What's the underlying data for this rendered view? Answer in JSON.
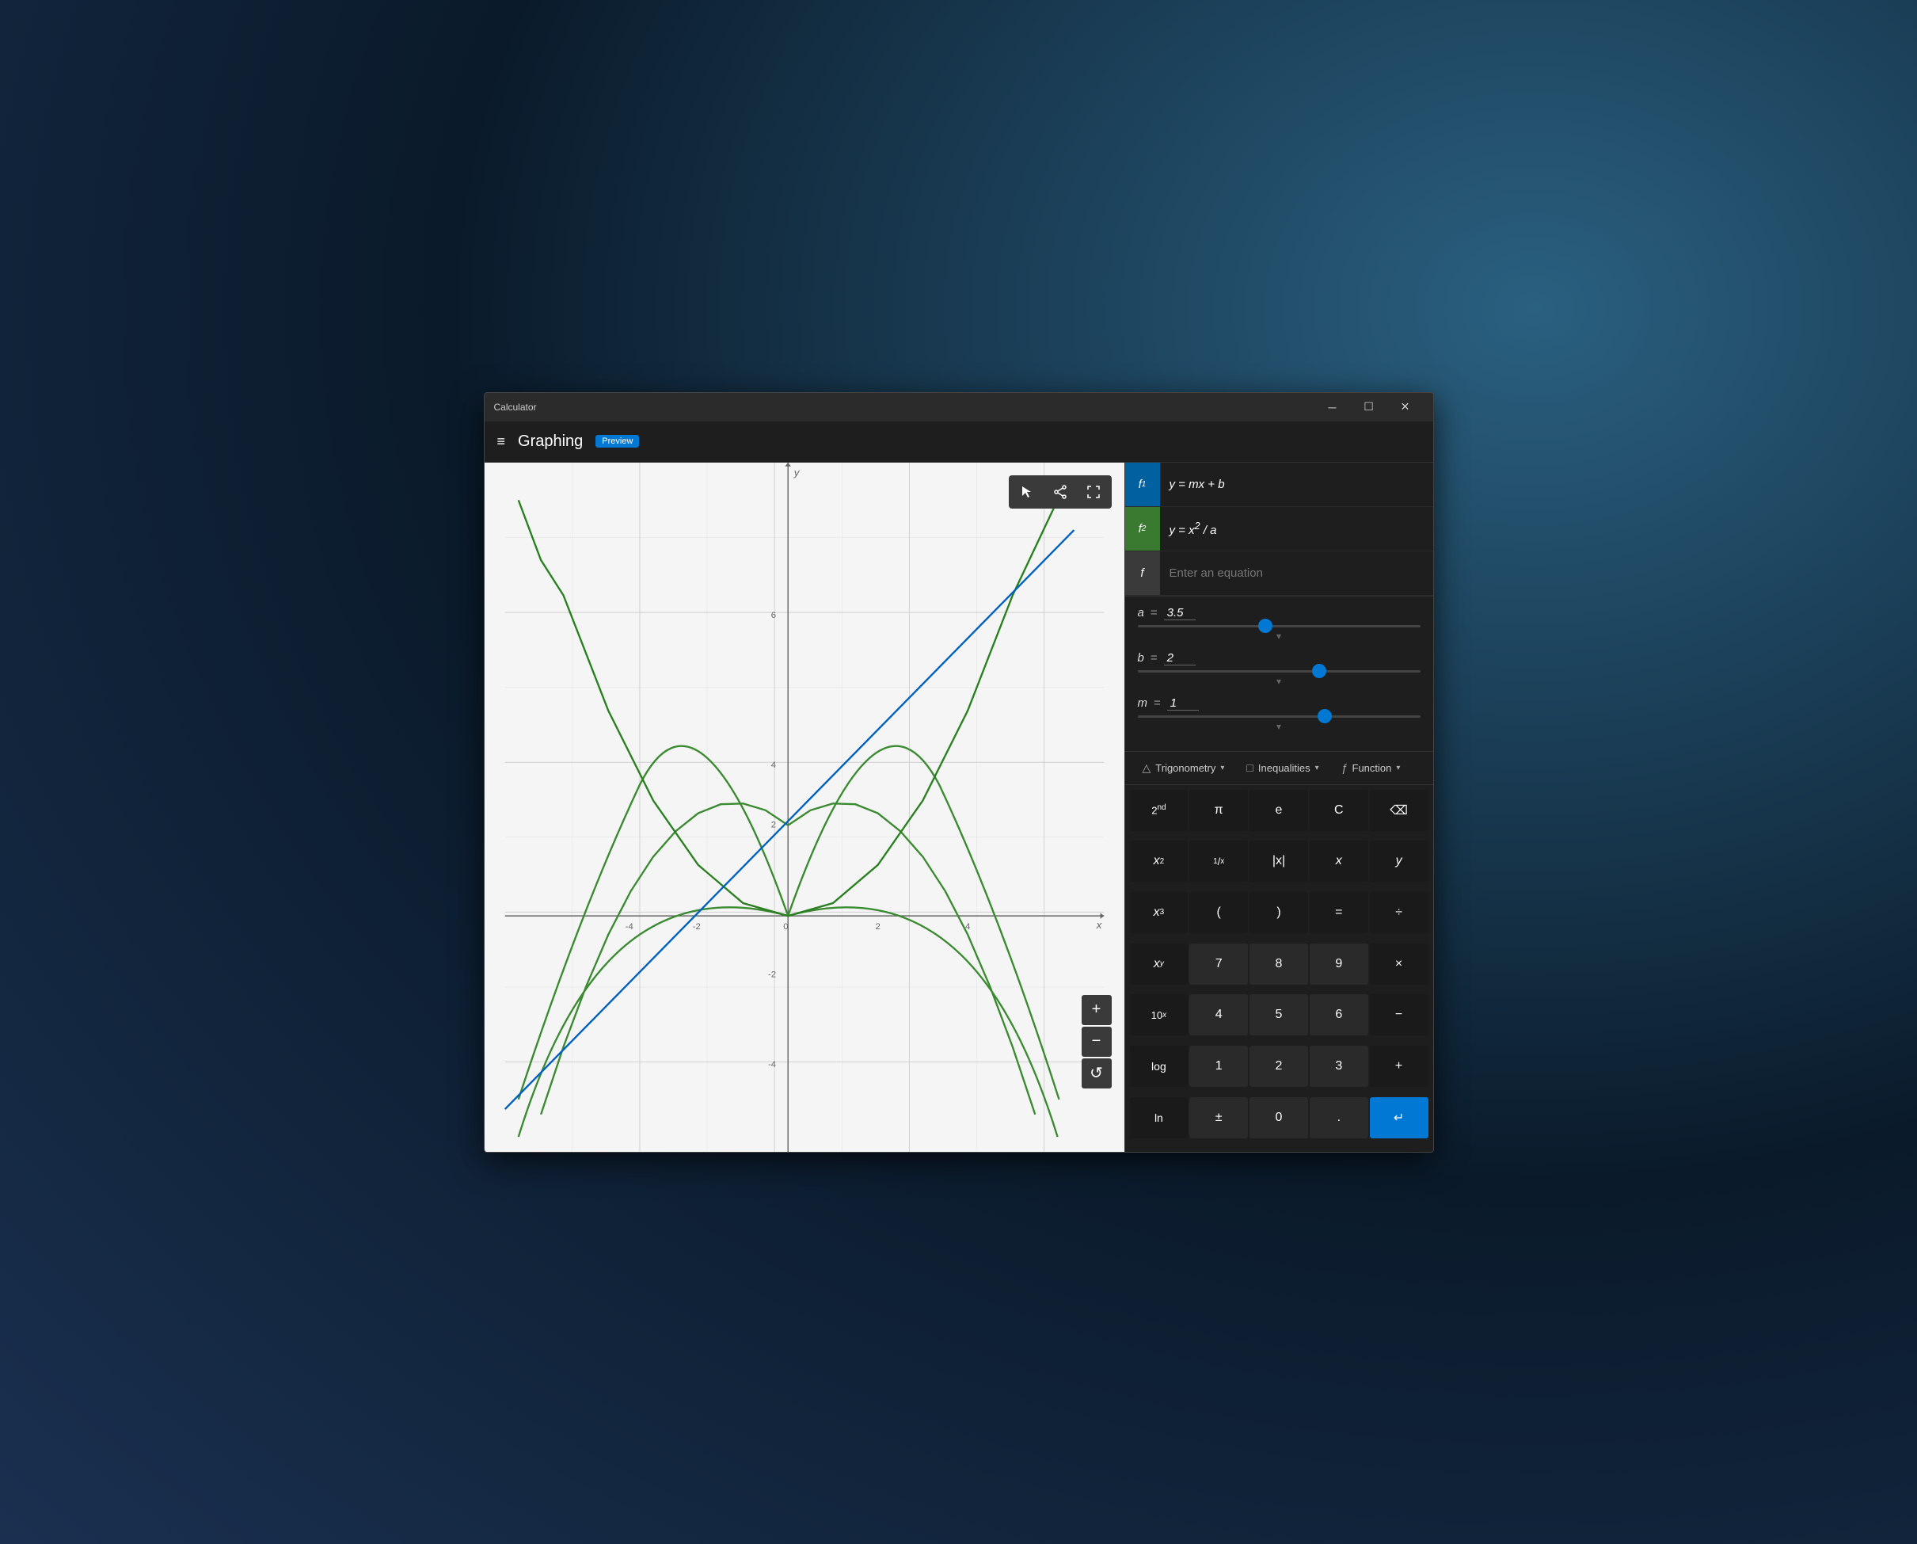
{
  "window": {
    "title": "Calculator",
    "min_label": "─",
    "max_label": "☐",
    "close_label": "✕"
  },
  "appbar": {
    "menu_icon": "≡",
    "title": "Graphing",
    "badge": "Preview"
  },
  "graph_toolbar": {
    "cursor_icon": "▷",
    "share_icon": "⇪",
    "fullscreen_icon": "⛶"
  },
  "equations": [
    {
      "id": "f1",
      "color": "blue",
      "label": "f",
      "subscript": "1",
      "formula": "y = mx + b"
    },
    {
      "id": "f2",
      "color": "green",
      "label": "f",
      "subscript": "2",
      "formula": "y = x² / a"
    },
    {
      "id": "f3",
      "color": "gray",
      "label": "f",
      "subscript": "",
      "formula": "",
      "placeholder": "Enter an equation"
    }
  ],
  "variables": [
    {
      "name": "a",
      "value": "3.5",
      "slider_pct": 45
    },
    {
      "name": "b",
      "value": "2",
      "slider_pct": 65
    },
    {
      "name": "m",
      "value": "1",
      "slider_pct": 67
    }
  ],
  "keyboard": {
    "tabs": [
      {
        "icon": "△",
        "label": "Trigonometry",
        "arrow": "▾"
      },
      {
        "icon": "□",
        "label": "Inequalities",
        "arrow": "▾"
      },
      {
        "icon": "ƒ",
        "label": "Function",
        "arrow": "▾"
      }
    ],
    "keys": [
      {
        "label": "2ⁿᵈ",
        "style": "dark",
        "name": "second"
      },
      {
        "label": "π",
        "style": "dark",
        "name": "pi"
      },
      {
        "label": "e",
        "style": "dark",
        "name": "euler"
      },
      {
        "label": "C",
        "style": "dark",
        "name": "clear"
      },
      {
        "label": "⌫",
        "style": "backspace",
        "name": "backspace"
      },
      {
        "label": "x²",
        "style": "dark",
        "name": "x-squared"
      },
      {
        "label": "¹⁄ₓ",
        "style": "dark",
        "name": "reciprocal"
      },
      {
        "label": "|x|",
        "style": "dark",
        "name": "abs"
      },
      {
        "label": "x",
        "style": "dark",
        "name": "var-x"
      },
      {
        "label": "y",
        "style": "dark",
        "name": "var-y"
      },
      {
        "label": "x³",
        "style": "dark",
        "name": "x-cubed"
      },
      {
        "label": "(",
        "style": "dark",
        "name": "open-paren"
      },
      {
        "label": ")",
        "style": "dark",
        "name": "close-paren"
      },
      {
        "label": "=",
        "style": "dark",
        "name": "equals"
      },
      {
        "label": "÷",
        "style": "dark",
        "name": "divide"
      },
      {
        "label": "xʸ",
        "style": "dark",
        "name": "x-power-y"
      },
      {
        "label": "7",
        "style": "normal",
        "name": "seven"
      },
      {
        "label": "8",
        "style": "normal",
        "name": "eight"
      },
      {
        "label": "9",
        "style": "normal",
        "name": "nine"
      },
      {
        "label": "×",
        "style": "dark",
        "name": "multiply"
      },
      {
        "label": "10ˣ",
        "style": "dark",
        "name": "ten-power-x"
      },
      {
        "label": "4",
        "style": "normal",
        "name": "four"
      },
      {
        "label": "5",
        "style": "normal",
        "name": "five"
      },
      {
        "label": "6",
        "style": "normal",
        "name": "six"
      },
      {
        "label": "−",
        "style": "dark",
        "name": "minus"
      },
      {
        "label": "log",
        "style": "dark",
        "name": "log"
      },
      {
        "label": "1",
        "style": "normal",
        "name": "one"
      },
      {
        "label": "2",
        "style": "normal",
        "name": "two"
      },
      {
        "label": "3",
        "style": "normal",
        "name": "three"
      },
      {
        "label": "+",
        "style": "dark",
        "name": "plus"
      },
      {
        "label": "ln",
        "style": "dark",
        "name": "ln"
      },
      {
        "label": "±",
        "style": "normal",
        "name": "plus-minus"
      },
      {
        "label": "0",
        "style": "normal",
        "name": "zero"
      },
      {
        "label": ".",
        "style": "normal",
        "name": "decimal"
      },
      {
        "label": "↵",
        "style": "blue",
        "name": "enter"
      }
    ]
  },
  "zoom": {
    "plus": "+",
    "minus": "−",
    "reset": "↺"
  },
  "graph": {
    "x_label": "x",
    "y_label": "y",
    "x_ticks": [
      "-4",
      "-2",
      "0",
      "2",
      "4"
    ],
    "y_ticks": [
      "-4",
      "-2",
      "2",
      "4",
      "6"
    ]
  }
}
